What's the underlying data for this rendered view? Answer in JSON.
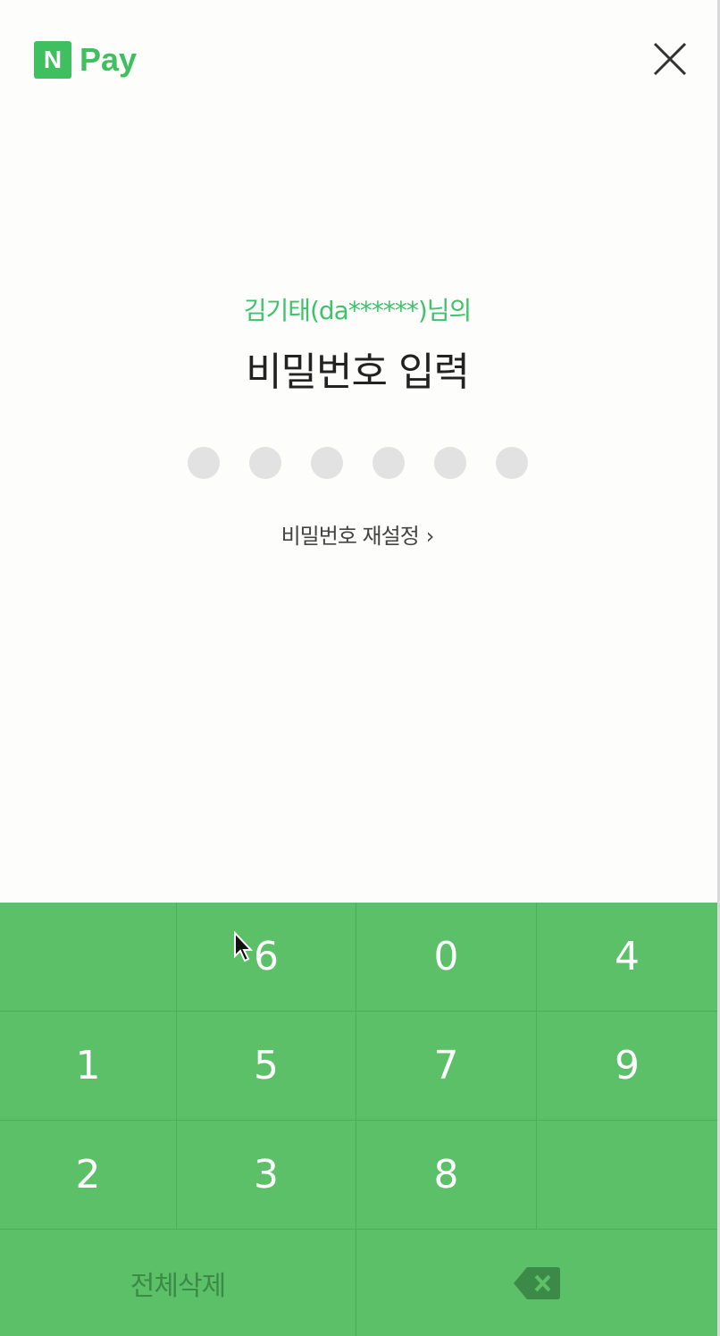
{
  "header": {
    "logo_letter": "N",
    "logo_text": "Pay",
    "close_icon": "close-icon"
  },
  "prompt": {
    "subtitle": "김기태(da******)님의",
    "title": "비밀번호 입력"
  },
  "pin": {
    "length": 6,
    "filled": 0
  },
  "reset_link": {
    "label": "비밀번호 재설정",
    "chevron": "›"
  },
  "keypad": {
    "rows": [
      [
        "",
        "6",
        "0",
        "4"
      ],
      [
        "1",
        "5",
        "7",
        "9"
      ],
      [
        "2",
        "3",
        "8",
        ""
      ]
    ],
    "clear_label": "전체삭제",
    "backspace_icon": "backspace-icon"
  },
  "colors": {
    "brand_green": "#3fbf5f",
    "keypad_green": "#5bc067",
    "dot_empty": "#e1e2e1"
  }
}
